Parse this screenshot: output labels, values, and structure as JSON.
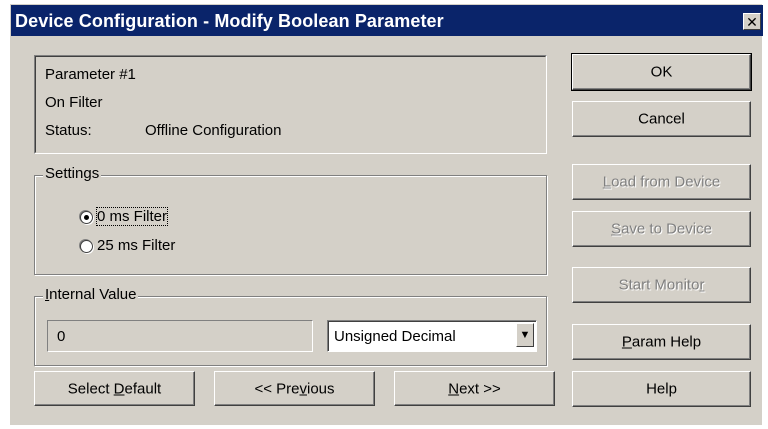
{
  "window": {
    "title": "Device Configuration - Modify Boolean Parameter",
    "close_glyph": "✕",
    "colors": {
      "titlebar": "#0a246a",
      "face": "#d4d0c8",
      "disabled_text": "#808080"
    }
  },
  "info": {
    "parameter": "Parameter #1",
    "name": "On Filter",
    "status_label": "Status:",
    "status_value": "Offline Configuration"
  },
  "settings": {
    "legend": "Settings",
    "options": [
      {
        "label": "0 ms Filter",
        "selected": true
      },
      {
        "label": "25 ms Filter",
        "selected": false
      }
    ]
  },
  "internal_value": {
    "legend": "Internal Value",
    "value": "0",
    "format_selected": "Unsigned Decimal",
    "dropdown_icon": "triangle-down-icon"
  },
  "bottom_buttons": {
    "select_default": "Select Default",
    "previous": "<< Previous",
    "next": "Next >>"
  },
  "side_buttons": {
    "ok": "OK",
    "cancel": "Cancel",
    "load_from_device": "Load from Device",
    "save_to_device": "Save to Device",
    "start_monitor": "Start Monitor",
    "param_help": "Param Help",
    "help": "Help"
  }
}
